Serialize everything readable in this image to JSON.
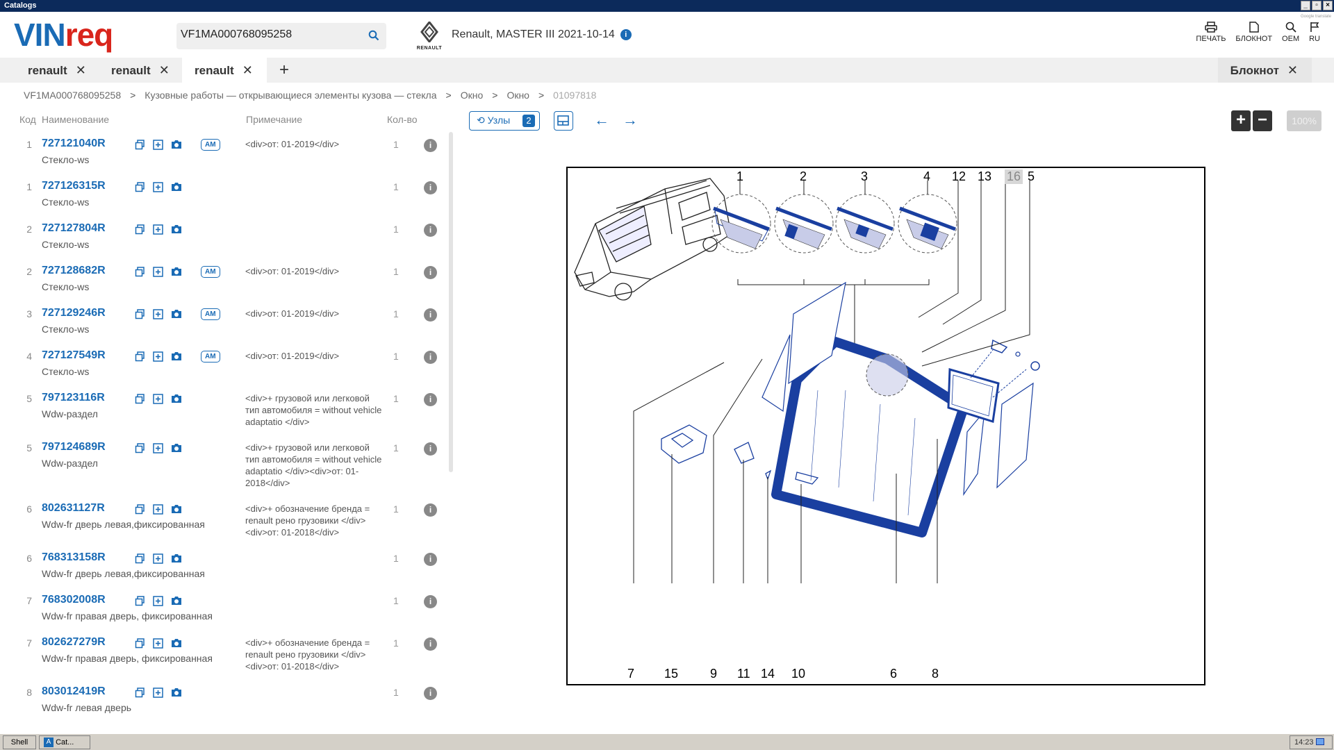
{
  "window": {
    "title": "Catalogs"
  },
  "header": {
    "logo_vin": "VIN",
    "logo_req": "req",
    "vin_value": "VF1MA000768095258",
    "brand_text": "RENAULT",
    "vehicle": "Renault, MASTER III 2021-10-14",
    "actions": {
      "print": "ПЕЧАТЬ",
      "notebook": "БЛОКНОТ",
      "oem": "OEM",
      "lang": "RU"
    },
    "translate_note": "Google translate"
  },
  "tabs": [
    {
      "label": "renault"
    },
    {
      "label": "renault"
    },
    {
      "label": "renault"
    }
  ],
  "tab_add": "+",
  "notebook_tab": "Блокнот",
  "breadcrumb": [
    "VF1MA000768095258",
    "Кузовные работы — открывающиеся элементы кузова — стекла",
    "Окно",
    "Окно",
    "01097818"
  ],
  "columns": {
    "code": "Код",
    "name": "Наименование",
    "note": "Примечание",
    "qty": "Кол-во"
  },
  "parts": [
    {
      "num": "1",
      "code": "727121040R",
      "name": "Стекло-ws",
      "am": "AM",
      "note": "<div>от: 01-2019</div>",
      "qty": "1"
    },
    {
      "num": "1",
      "code": "727126315R",
      "name": "Стекло-ws",
      "am": "",
      "note": "",
      "qty": "1"
    },
    {
      "num": "2",
      "code": "727127804R",
      "name": "Стекло-ws",
      "am": "",
      "note": "",
      "qty": "1"
    },
    {
      "num": "2",
      "code": "727128682R",
      "name": "Стекло-ws",
      "am": "AM",
      "note": "<div>от: 01-2019</div>",
      "qty": "1"
    },
    {
      "num": "3",
      "code": "727129246R",
      "name": "Стекло-ws",
      "am": "AM",
      "note": "<div>от: 01-2019</div>",
      "qty": "1"
    },
    {
      "num": "4",
      "code": "727127549R",
      "name": "Стекло-ws",
      "am": "AM",
      "note": "<div>от: 01-2019</div>",
      "qty": "1"
    },
    {
      "num": "5",
      "code": "797123116R",
      "name": "Wdw-раздел",
      "am": "",
      "note": "<div>+ грузовой или легковой тип автомобиля = without vehicle adaptatio </div>",
      "qty": "1"
    },
    {
      "num": "5",
      "code": "797124689R",
      "name": "Wdw-раздел",
      "am": "",
      "note": "<div>+ грузовой или легковой тип автомобиля = without vehicle adaptatio </div><div>от: 01-2018</div>",
      "qty": "1"
    },
    {
      "num": "6",
      "code": "802631127R",
      "name": "Wdw-fr дверь левая,фиксированная",
      "am": "",
      "note": "<div>+ обозначение бренда = renault рено грузовики </div><div>от: 01-2018</div>",
      "qty": "1"
    },
    {
      "num": "6",
      "code": "768313158R",
      "name": "Wdw-fr дверь левая,фиксированная",
      "am": "",
      "note": "",
      "qty": "1"
    },
    {
      "num": "7",
      "code": "768302008R",
      "name": "Wdw-fr правая дверь, фиксированная",
      "am": "",
      "note": "",
      "qty": "1"
    },
    {
      "num": "7",
      "code": "802627279R",
      "name": "Wdw-fr правая дверь, фиксированная",
      "am": "",
      "note": "<div>+ обозначение бренда = renault рено грузовики </div><div>от: 01-2018</div>",
      "qty": "1"
    },
    {
      "num": "8",
      "code": "803012419R",
      "name": "Wdw-fr левая дверь",
      "am": "",
      "note": "",
      "qty": "1"
    }
  ],
  "toolbar": {
    "uzly_label": "Узлы",
    "uzly_count": "2",
    "zoom_in": "+",
    "zoom_out": "−",
    "zoom_pct": "100%"
  },
  "diagram": {
    "top_callouts": [
      "1",
      "2",
      "3",
      "4",
      "12",
      "13",
      "16",
      "5"
    ],
    "bottom_callouts": [
      "7",
      "15",
      "9",
      "11",
      "14",
      "10",
      "6",
      "8"
    ],
    "highlighted": "16"
  },
  "taskbar": {
    "shell": "Shell",
    "app": "Cat...",
    "clock": "14:23"
  },
  "colors": {
    "accent": "#1a6bb5",
    "logo_red": "#d9251c",
    "titlebar": "#0c2a5b"
  }
}
